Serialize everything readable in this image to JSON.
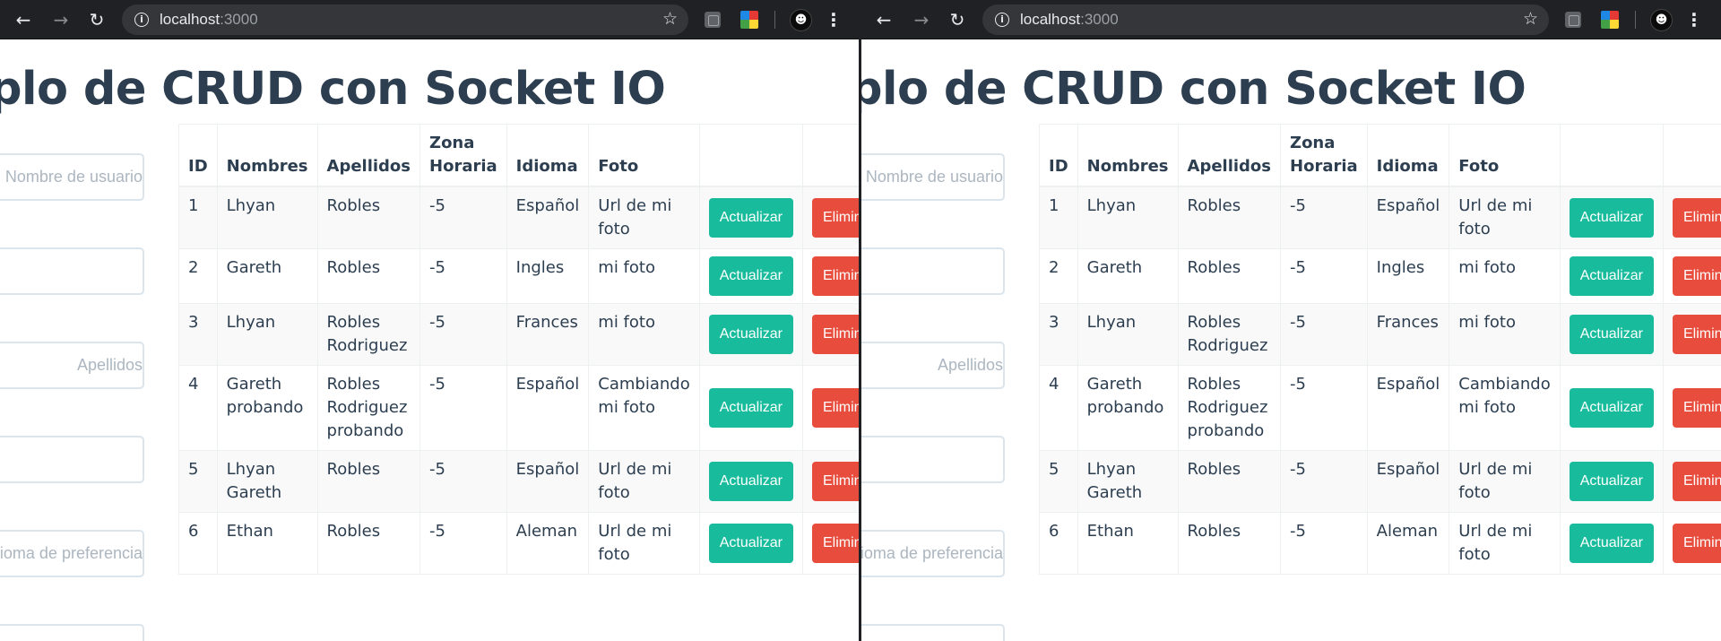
{
  "browser": {
    "url_host": "localhost",
    "url_port": ":3000"
  },
  "page": {
    "title": "Ejemplo de CRUD con Socket IO"
  },
  "form": {
    "placeholders": [
      "Nombre de usuario",
      "",
      "Apellidos",
      "",
      "Idioma de preferencia",
      ""
    ]
  },
  "table": {
    "headers": {
      "id": "ID",
      "nombres": "Nombres",
      "apellidos": "Apellidos",
      "zona": "Zona Horaria",
      "idioma": "Idioma",
      "foto": "Foto"
    },
    "update_label": "Actualizar",
    "delete_label": "Eliminar",
    "rows": [
      {
        "id": "1",
        "nombres": "Lhyan",
        "apellidos": "Robles",
        "zona": "-5",
        "idioma": "Español",
        "foto": "Url de mi foto"
      },
      {
        "id": "2",
        "nombres": "Gareth",
        "apellidos": "Robles",
        "zona": "-5",
        "idioma": "Ingles",
        "foto": "mi foto"
      },
      {
        "id": "3",
        "nombres": "Lhyan",
        "apellidos": "Robles Rodriguez",
        "zona": "-5",
        "idioma": "Frances",
        "foto": "mi foto"
      },
      {
        "id": "4",
        "nombres": "Gareth probando",
        "apellidos": "Robles Rodriguez probando",
        "zona": "-5",
        "idioma": "Español",
        "foto": "Cambiando mi foto"
      },
      {
        "id": "5",
        "nombres": "Lhyan Gareth",
        "apellidos": "Robles",
        "zona": "-5",
        "idioma": "Español",
        "foto": "Url de mi foto"
      },
      {
        "id": "6",
        "nombres": "Ethan",
        "apellidos": "Robles",
        "zona": "-5",
        "idioma": "Aleman",
        "foto": "Url de mi foto"
      }
    ]
  },
  "colors": {
    "update": "#18bc9c",
    "delete": "#e74c3c",
    "text": "#2c3e50",
    "chrome": "#202124"
  },
  "icons": [
    "back-icon",
    "forward-icon",
    "reload-icon",
    "info-icon",
    "star-icon",
    "extension-icon",
    "color-extension-icon",
    "avatar-icon",
    "menu-icon"
  ]
}
